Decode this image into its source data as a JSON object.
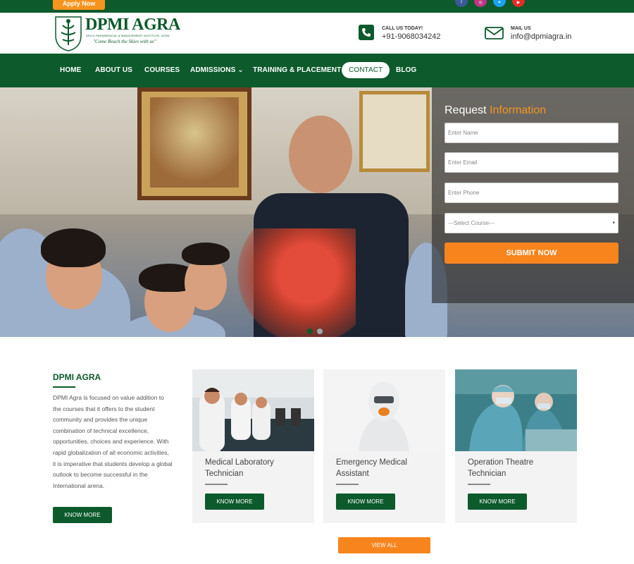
{
  "topbar": {
    "apply_label": "Apply Now",
    "socials": [
      "facebook-icon",
      "instagram-icon",
      "twitter-icon",
      "youtube-icon"
    ]
  },
  "header": {
    "logo_title": "DPMI AGRA",
    "logo_subtitle": "DELHI PARAMEDICAL & MANAGEMENT INSTITUTE, AGRA",
    "logo_tagline": "\"Come Reach the Skies with us\"",
    "call_label": "CALL US TODAY!",
    "call_value": "+91-9068034242",
    "mail_label": "MAIL US",
    "mail_value": "info@dpmiagra.in"
  },
  "nav": {
    "items": [
      {
        "label": "HOME"
      },
      {
        "label": "ABOUT US"
      },
      {
        "label": "COURSES"
      },
      {
        "label": "ADMISSIONS ⌄"
      },
      {
        "label": "TRAINING & PLACEMENT"
      },
      {
        "label": "CONTACT"
      },
      {
        "label": "BLOG"
      }
    ],
    "active": "CONTACT"
  },
  "form": {
    "title_plain": "Request ",
    "title_highlight": "Information",
    "name_placeholder": "Enter Name",
    "email_placeholder": "Enter Email",
    "phone_placeholder": "Enter Phone",
    "course_selected": "---Select Course---",
    "submit_label": "SUBMIT NOW"
  },
  "about": {
    "title": "DPMI AGRA",
    "text": "DPMI Agra is focused on value addition to the courses that it offers to the student community and provides the unique combination of technical excellence, opportunities, choices and experience. With rapid globalization of all economic activities, it is imperative that students develop a global outlook to become successful in the International arena.",
    "button_label": "KNOW MORE"
  },
  "courses": [
    {
      "title": "Medical Laboratory Technician",
      "button_label": "KNOW MORE"
    },
    {
      "title": "Emergency Medical Assistant",
      "button_label": "KNOW MORE"
    },
    {
      "title": "Operation Theatre Technician",
      "button_label": "KNOW MORE"
    }
  ],
  "view_all_label": "VIEW ALL",
  "colors": {
    "brand_green": "#0d5a2c",
    "accent_orange": "#f7841d"
  }
}
